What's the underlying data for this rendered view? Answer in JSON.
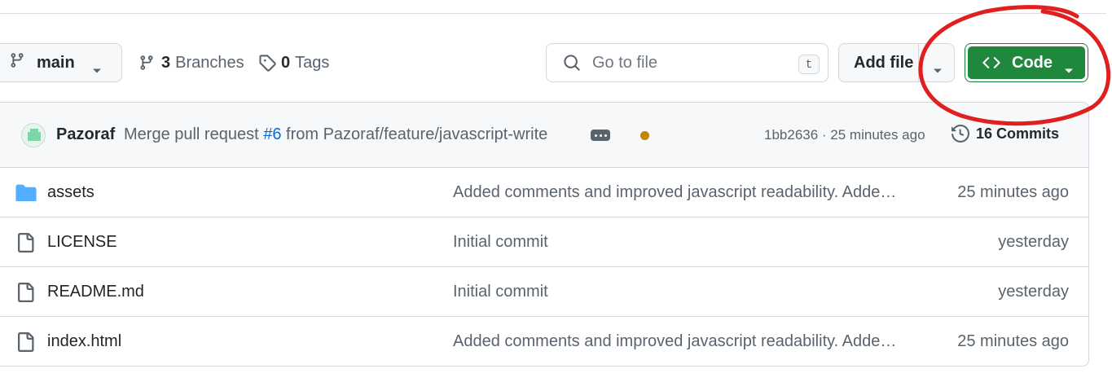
{
  "toolbar": {
    "branch": {
      "label": "main",
      "icon": "git-branch-icon"
    },
    "branches": {
      "count": "3",
      "label": "Branches"
    },
    "tags": {
      "count": "0",
      "label": "Tags"
    },
    "search": {
      "placeholder": "Go to file",
      "shortcut": "t"
    },
    "add_file": {
      "label": "Add file"
    },
    "code": {
      "label": "Code",
      "color": "#1f883d"
    }
  },
  "latest_commit": {
    "author": "Pazoraf",
    "message_prefix": "Merge pull request",
    "pr_number": "#6",
    "message_suffix": "from Pazoraf/feature/javascript-write",
    "sha_time": "1bb2636 · 25 minutes ago",
    "commits_count": "16 Commits",
    "status_color": "#bf8700"
  },
  "files": [
    {
      "name": "assets",
      "type": "folder",
      "message": "Added comments and improved javascript readability. Adde…",
      "age": "25 minutes ago"
    },
    {
      "name": "LICENSE",
      "type": "file",
      "message": "Initial commit",
      "age": "yesterday"
    },
    {
      "name": "README.md",
      "type": "file",
      "message": "Initial commit",
      "age": "yesterday"
    },
    {
      "name": "index.html",
      "type": "file",
      "message": "Added comments and improved javascript readability. Adde…",
      "age": "25 minutes ago"
    }
  ],
  "annotation": {
    "shape": "hand-drawn circle",
    "color": "#e02020",
    "target": "code-button"
  }
}
